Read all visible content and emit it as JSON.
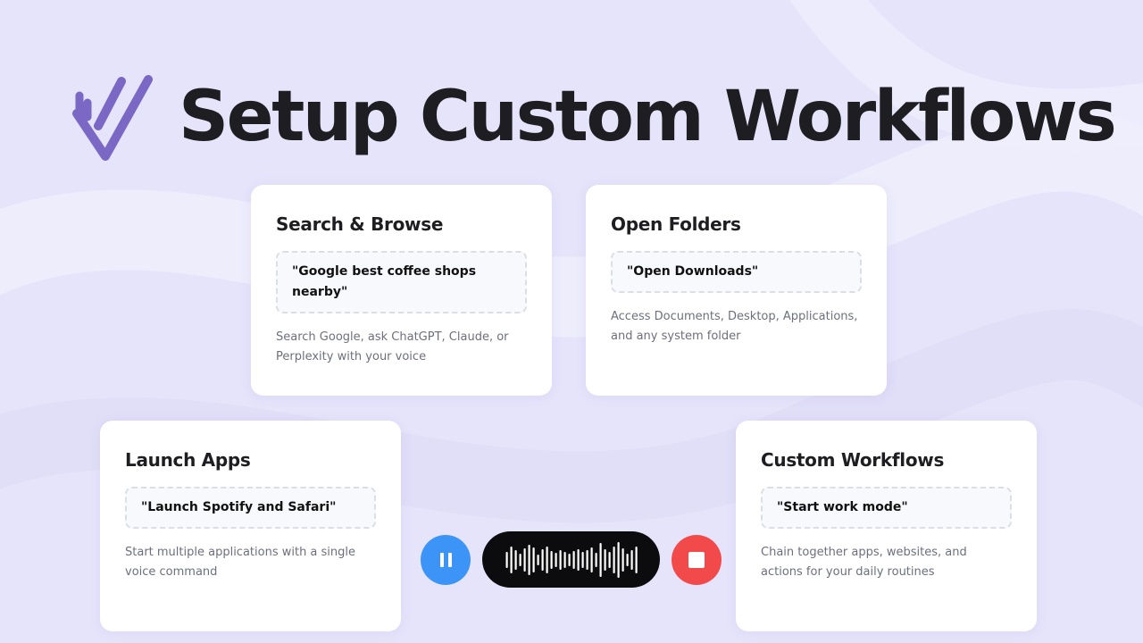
{
  "header": {
    "title": "Setup Custom Workflows",
    "logo_icon": "logo-icon"
  },
  "cards": {
    "search": {
      "title": "Search & Browse",
      "command": "\"Google best coffee shops nearby\"",
      "description": "Search Google, ask ChatGPT, Claude, or Perplexity with your voice"
    },
    "folders": {
      "title": "Open Folders",
      "command": "\"Open Downloads\"",
      "description": "Access Documents, Desktop, Applications, and any system folder"
    },
    "apps": {
      "title": "Launch Apps",
      "command": "\"Launch Spotify and Safari\"",
      "description": "Start multiple applications with a single voice command"
    },
    "workflows": {
      "title": "Custom Workflows",
      "command": "\"Start work mode\"",
      "description": "Chain together apps, websites, and actions for your daily routines"
    }
  },
  "controls": {
    "pause_icon": "pause-icon",
    "waveform_icon": "waveform-icon",
    "stop_icon": "stop-icon"
  },
  "colors": {
    "background": "#e6e4fb",
    "logo": "#7a68c4",
    "title": "#1e1d22",
    "pause_button": "#3d94f7",
    "stop_button": "#f24a4a",
    "waveform_pill": "#0c0c0e",
    "description": "#6e6f7e"
  }
}
